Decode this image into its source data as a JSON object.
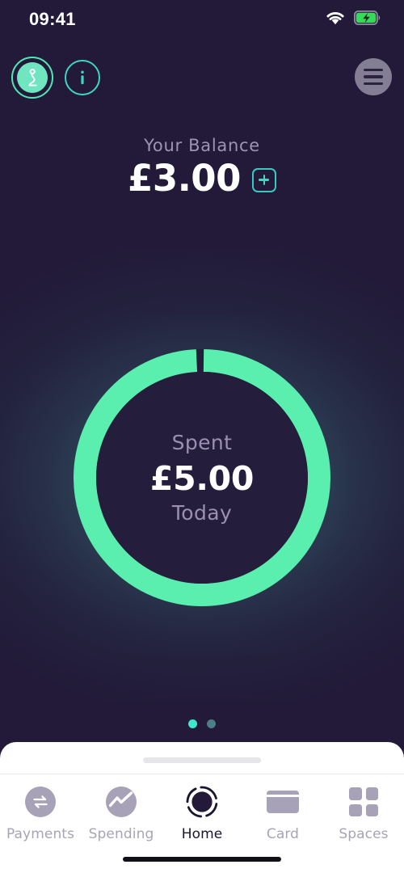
{
  "status_bar": {
    "time": "09:41",
    "wifi_icon": "wifi-icon",
    "battery_icon": "battery-charging-icon",
    "battery_color": "#37D95A"
  },
  "header": {
    "avatar": {
      "icon": "avatar-person-icon",
      "ring_color": "#52E6B8",
      "fill_color": "#6FE6C0"
    },
    "info_button": {
      "label": "i",
      "icon": "info-icon",
      "color": "#3FD6C0"
    },
    "menu_button": {
      "icon": "hamburger-menu-icon",
      "color": "#837E93"
    }
  },
  "balance": {
    "label": "Your Balance",
    "amount": "£3.00",
    "add_money_button": {
      "icon": "plus-icon",
      "color": "#46D3C6"
    }
  },
  "spending_ring": {
    "label": "Spent",
    "amount": "£5.00",
    "period": "Today",
    "ring_color": "#5BEFAF",
    "track_color": "#251D3C",
    "progress_percent": 99
  },
  "pager": {
    "dots": [
      {
        "state": "active",
        "color": "#3DE8C8"
      },
      {
        "state": "inactive",
        "color": "#4C7E87"
      }
    ]
  },
  "sheet": {
    "handle": "drag-handle"
  },
  "tabbar": {
    "items": [
      {
        "label": "Payments",
        "icon": "transfer-arrows-icon",
        "active": false
      },
      {
        "label": "Spending",
        "icon": "chart-line-icon",
        "active": false
      },
      {
        "label": "Home",
        "icon": "home-ring-icon",
        "active": true
      },
      {
        "label": "Card",
        "icon": "card-icon",
        "active": false
      },
      {
        "label": "Spaces",
        "icon": "grid-squares-icon",
        "active": false
      }
    ]
  },
  "theme": {
    "background": "#221A38",
    "accent_mint": "#5BEFAF",
    "accent_teal": "#3FD6C0",
    "muted_text": "#9A90B2"
  }
}
